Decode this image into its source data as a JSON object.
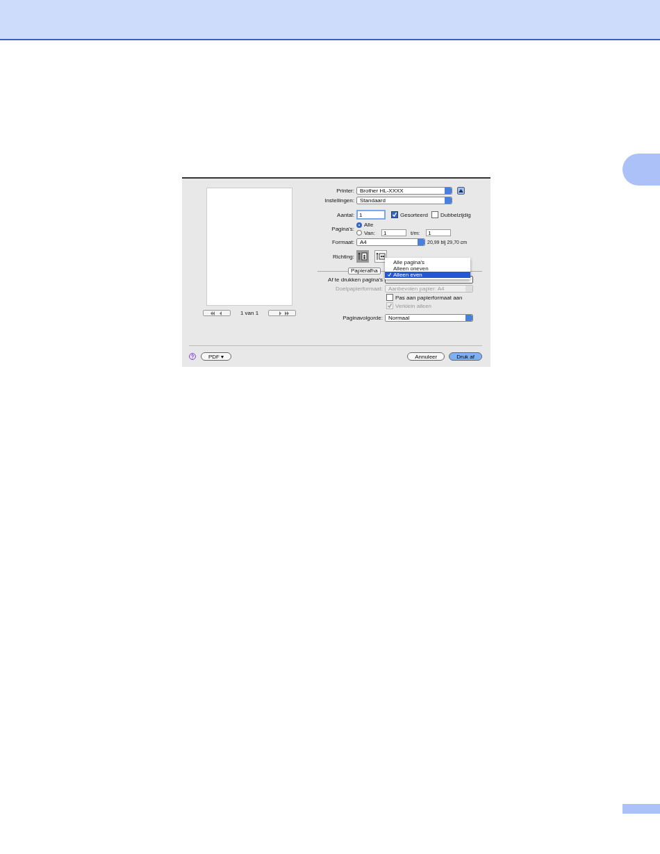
{
  "dialog": {
    "printer": {
      "label": "Printer:",
      "value": "Brother HL-XXXX",
      "expanded": false
    },
    "preset": {
      "label": "Instellingen:",
      "value": "Standaard"
    },
    "copies": {
      "label": "Aantal:",
      "value": "1"
    },
    "copy_options": [
      {
        "label": "Gesorteerd",
        "checked": true
      },
      {
        "label": "Dubbelzijdig",
        "checked": false
      }
    ],
    "pages": {
      "label": "Pagina's:",
      "options": [
        {
          "label": "Alle",
          "selected": true
        },
        {
          "label": "Van:",
          "selected": false
        }
      ],
      "from": "1",
      "to_label": "t/m:",
      "to": "1"
    },
    "paper_size": {
      "label": "Formaat:",
      "value": "A4",
      "info": "20,99 bij 29,70 cm"
    },
    "orientation": {
      "label": "Richting:",
      "options": [
        {
          "kind": "portrait",
          "selected": true
        },
        {
          "kind": "landscape",
          "selected": false
        }
      ]
    },
    "panel_popup": {
      "value": "Papierafha"
    },
    "pages_to_print": {
      "label": "Af te drukken pagina's",
      "menu": [
        {
          "label": "Alle pagina's",
          "selected": false
        },
        {
          "label": "Alleen oneven",
          "selected": false
        },
        {
          "label": "Alleen even",
          "selected": true
        }
      ]
    },
    "destination_size": {
      "label": "Doelpapierformaat:",
      "value": "Aanbevolen papier: A4",
      "disabled": true
    },
    "scale_options": [
      {
        "label": "Pas aan papierformaat aan",
        "checked": false,
        "disabled": false
      },
      {
        "label": "Verklein alleen",
        "checked": true,
        "disabled": true
      }
    ],
    "page_order": {
      "label": "Paginavolgorde:",
      "value": "Normaal"
    },
    "preview_nav": {
      "counter": "1 van 1"
    },
    "pdf_button": "PDF ▾",
    "buttons": [
      {
        "label": "Annuleer",
        "default": false
      },
      {
        "label": "Druk af",
        "default": true
      }
    ]
  }
}
